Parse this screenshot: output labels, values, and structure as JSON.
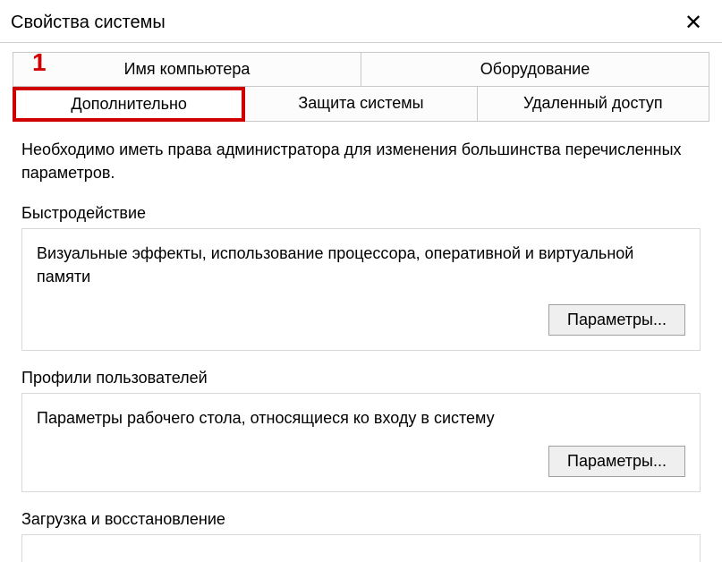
{
  "window": {
    "title": "Свойства системы",
    "close_glyph": "✕"
  },
  "annotation": {
    "marker": "1"
  },
  "tabs": {
    "row1": [
      {
        "label": "Имя компьютера"
      },
      {
        "label": "Оборудование"
      }
    ],
    "row2": [
      {
        "label": "Дополнительно",
        "active": true,
        "highlighted": true
      },
      {
        "label": "Защита системы"
      },
      {
        "label": "Удаленный доступ"
      }
    ]
  },
  "content": {
    "intro": "Необходимо иметь права администратора для изменения большинства перечисленных параметров."
  },
  "groups": {
    "performance": {
      "title": "Быстродействие",
      "desc": "Визуальные эффекты, использование процессора, оперативной и виртуальной памяти",
      "button": "Параметры..."
    },
    "profiles": {
      "title": "Профили пользователей",
      "desc": "Параметры рабочего стола, относящиеся ко входу в систему",
      "button": "Параметры..."
    },
    "startup": {
      "title": "Загрузка и восстановление"
    }
  }
}
